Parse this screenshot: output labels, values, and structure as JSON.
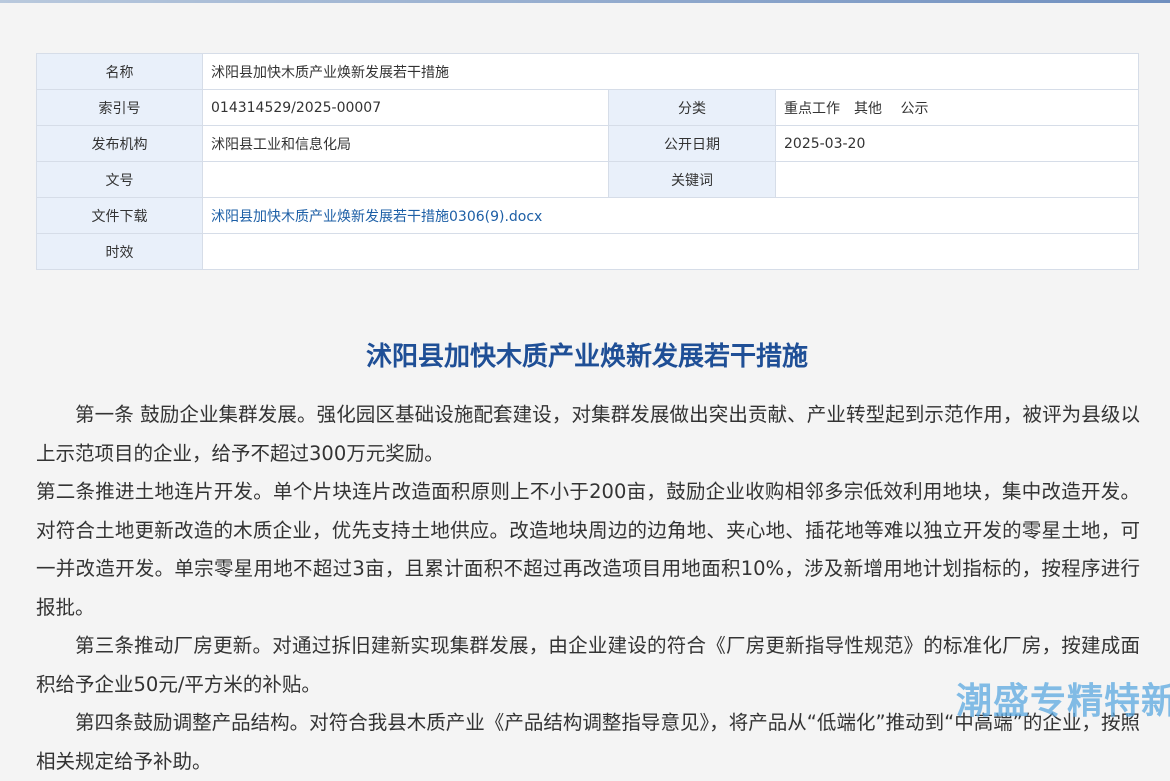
{
  "meta": {
    "name_label": "名称",
    "name_value": "沭阳县加快木质产业焕新发展若干措施",
    "index_label": "索引号",
    "index_value": "014314529/2025-00007",
    "category_label": "分类",
    "category_value": "重点工作　其他　 公示",
    "publisher_label": "发布机构",
    "publisher_value": "沭阳县工业和信息化局",
    "date_label": "公开日期",
    "date_value": "2025-03-20",
    "docno_label": "文号",
    "docno_value": "",
    "keywords_label": "关键词",
    "keywords_value": "",
    "download_label": "文件下载",
    "download_value": "沭阳县加快木质产业焕新发展若干措施0306(9).docx",
    "validity_label": "时效",
    "validity_value": ""
  },
  "article": {
    "title": "沭阳县加快木质产业焕新发展若干措施",
    "paragraphs": [
      "第一条 鼓励企业集群发展。强化园区基础设施配套建设，对集群发展做出突出贡献、产业转型起到示范作用，被评为县级以上示范项目的企业，给予不超过300万元奖励。",
      "第二条推进土地连片开发。单个片块连片改造面积原则上不小于200亩，鼓励企业收购相邻多宗低效利用地块，集中改造开发。对符合土地更新改造的木质企业，优先支持土地供应。改造地块周边的边角地、夹心地、插花地等难以独立开发的零星土地，可一并改造开发。单宗零星用地不超过3亩，且累计面积不超过再改造项目用地面积10%，涉及新增用地计划指标的，按程序进行报批。",
      "第三条推动厂房更新。对通过拆旧建新实现集群发展，由企业建设的符合《厂房更新指导性规范》的标准化厂房，按建成面积给予企业50元/平方米的补贴。",
      "第四条鼓励调整产品结构。对符合我县木质产业《产品结构调整指导意见》，将产品从“低端化”推动到“中高端”的企业，按照相关规定给予补助。"
    ]
  },
  "watermark": "潮盛专精特新"
}
